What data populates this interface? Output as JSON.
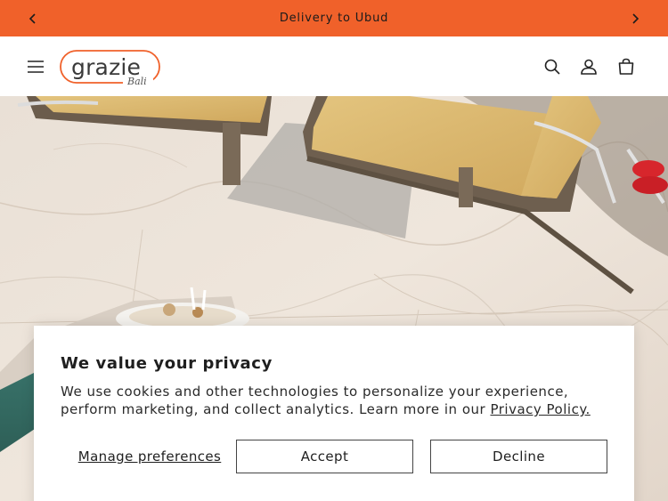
{
  "announcement": {
    "text": "Delivery to Ubud",
    "prev_icon": "chevron-left-icon",
    "next_icon": "chevron-right-icon",
    "background": "#f0612a"
  },
  "header": {
    "logo": {
      "name": "grazie",
      "sub": "Bali",
      "accent": "#f0612a"
    },
    "icons": [
      "menu-icon",
      "search-icon",
      "account-icon",
      "cart-icon"
    ]
  },
  "hero": {
    "image": "poolside-loungers-photo"
  },
  "cookie_banner": {
    "title": "We value your privacy",
    "body": "We use cookies and other technologies to personalize your experience, perform marketing, and collect analytics. Learn more in our ",
    "link_text": "Privacy Policy.",
    "manage_label": "Manage preferences",
    "accept_label": "Accept",
    "decline_label": "Decline"
  }
}
